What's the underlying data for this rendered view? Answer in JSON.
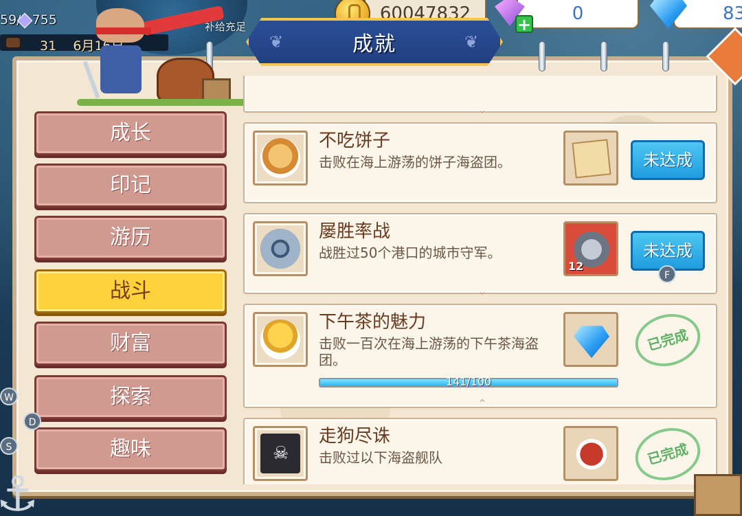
{
  "hud": {
    "hp": "59/",
    "hp_max": "755",
    "supply_label": "补给充足",
    "date_prefix": "31",
    "date_suffix": "6月16日",
    "gold": "60047832",
    "pink_gems": "0",
    "blue_gems": "83"
  },
  "title": "成就",
  "menu": [
    {
      "label": "成长",
      "active": false
    },
    {
      "label": "印记",
      "active": false
    },
    {
      "label": "游历",
      "active": false
    },
    {
      "label": "战斗",
      "active": true
    },
    {
      "label": "财富",
      "active": false
    },
    {
      "label": "探索",
      "active": false
    },
    {
      "label": "趣味",
      "active": false
    }
  ],
  "achievements": [
    {
      "name": "不吃饼子",
      "desc": "击败在海上游荡的饼子海盗团。",
      "icon": "pancake-icon",
      "reward_icon": "treasure-map-icon",
      "status": "未达成"
    },
    {
      "name": "屡胜率战",
      "desc": "战胜过50个港口的城市守军。",
      "icon": "shield-icon",
      "reward_icon": "cannon-icon",
      "reward_count": "12",
      "status": "未达成"
    },
    {
      "name": "下午茶的魅力",
      "desc": "击败一百次在海上游荡的下午茶海盗团。",
      "icon": "cake-icon",
      "reward_icon": "diamond-icon",
      "progress_text": "141/100",
      "progress": 1.0,
      "status": "已完成"
    },
    {
      "name": "走狗尽诛",
      "desc": "击败过以下海盗舰队",
      "icon": "pirate-flag-icon",
      "reward_icon": "meat-dish-icon",
      "status": "已完成"
    }
  ],
  "key_hints": {
    "w": "W",
    "d": "D",
    "s": "S",
    "f": "F"
  },
  "colors": {
    "button_blue": "#1f9ddf",
    "active_tab": "#ffd23c",
    "inactive_tab": "#d09a90",
    "stamp_green": "#5fb065"
  }
}
